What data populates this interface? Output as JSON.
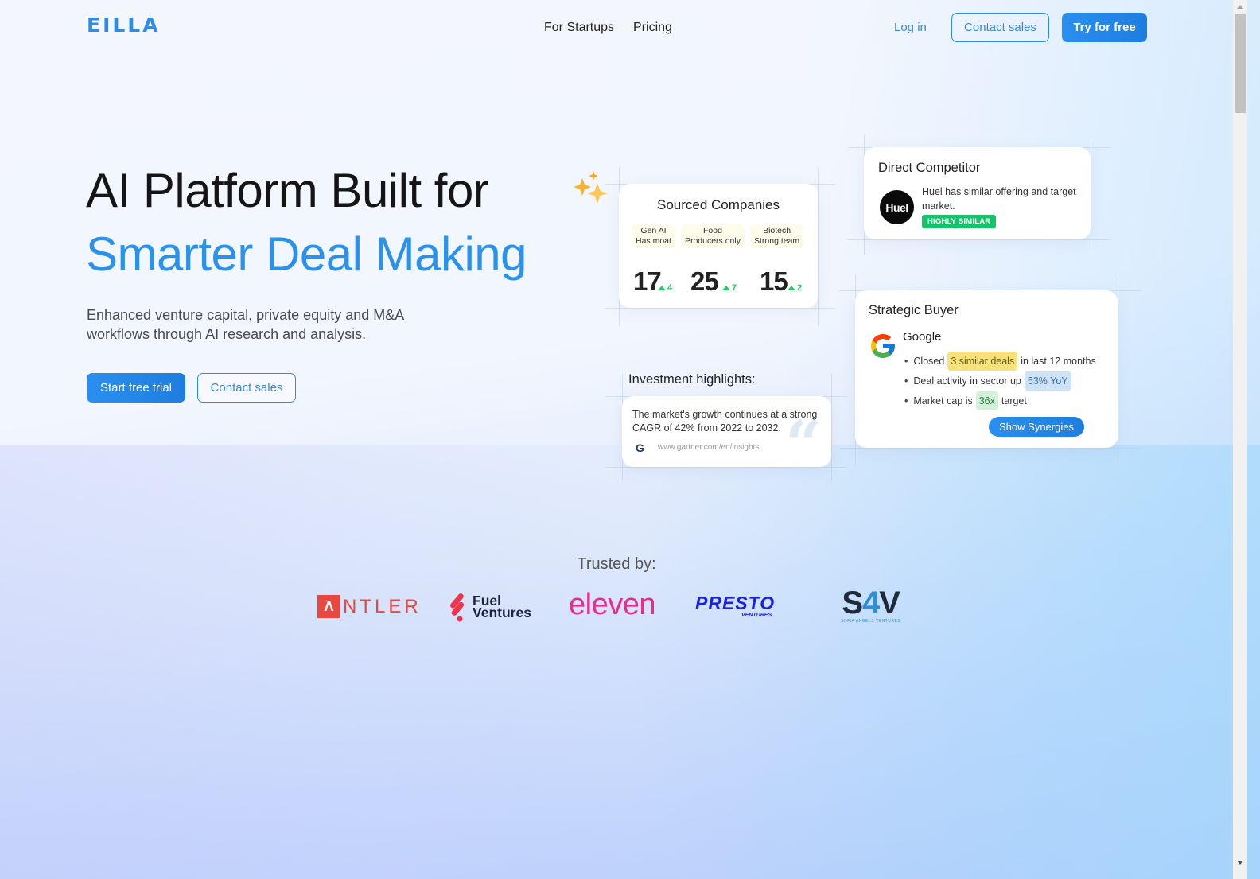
{
  "header": {
    "logo": "EILLA",
    "nav": [
      {
        "label": "For Startups"
      },
      {
        "label": "Pricing"
      }
    ],
    "login_label": "Log in",
    "contact_label": "Contact sales",
    "try_label": "Try for free"
  },
  "hero": {
    "title_line1": "AI Platform Built for",
    "title_line2": "Smarter Deal Making",
    "subtitle": "Enhanced venture capital, private equity and M&A workflows through AI research and analysis.",
    "start_label": "Start free trial",
    "contact_label": "Contact sales"
  },
  "sourced": {
    "title": "Sourced Companies",
    "tags": [
      {
        "line1": "Gen AI",
        "line2": "Has moat"
      },
      {
        "line1": "Food",
        "line2": "Producers only"
      },
      {
        "line1": "Biotech",
        "line2": "Strong team"
      }
    ],
    "counts": [
      {
        "value": "17",
        "delta": "4"
      },
      {
        "value": "25",
        "delta": "7"
      },
      {
        "value": "15",
        "delta": "2"
      }
    ]
  },
  "competitor": {
    "title": "Direct Competitor",
    "logo_text": "Huel",
    "description": "Huel has similar offering and target market.",
    "badge": "HIGHLY SIMILAR"
  },
  "buyer": {
    "title": "Strategic Buyer",
    "company": "Google",
    "items": [
      {
        "pre": "Closed",
        "highlight": "3 similar deals",
        "post": "in last 12 months"
      },
      {
        "pre": "Deal activity in sector up",
        "highlight": "53% YoY",
        "post": ""
      },
      {
        "pre": "Market cap is",
        "highlight": "36x",
        "post": "target"
      }
    ],
    "button_label": "Show Synergies"
  },
  "highlights": {
    "title": "Investment highlights:",
    "quote": "The market's growth continues at a strong CAGR of 42% from 2022 to 2032.",
    "source_initial": "G",
    "source_url": "www.gartner.com/en/insights"
  },
  "trusted": {
    "label": "Trusted by:",
    "logos": [
      {
        "name": "ANTLER",
        "mark": "Λ",
        "text": "NTLER"
      },
      {
        "name": "Fuel Ventures",
        "line1": "Fuel",
        "line2": "Ventures"
      },
      {
        "name": "eleven",
        "text": "eleven"
      },
      {
        "name": "Presto Ventures",
        "main": "PRESTO",
        "sub": "VENTURES"
      },
      {
        "name": "SAV",
        "s": "S",
        "four": "4",
        "v": "V",
        "sub": "SOFIA ANGELS VENTURES"
      }
    ]
  },
  "colors": {
    "brand": "#2b8de8",
    "headline_accent": "#2a92ea",
    "badge_green": "#15c46a",
    "delta_green": "#2cc56a"
  }
}
